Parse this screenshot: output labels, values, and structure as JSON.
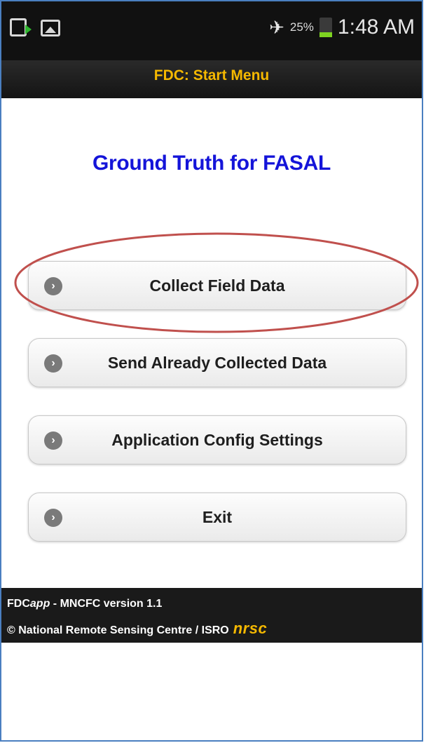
{
  "status_bar": {
    "battery_percent": "25%",
    "time": "1:48 AM",
    "icons": [
      "notification-upload-icon",
      "gallery-icon",
      "airplane-mode-icon",
      "battery-icon"
    ]
  },
  "header": {
    "title": "FDC: Start Menu"
  },
  "main": {
    "heading": "Ground Truth for FASAL",
    "buttons": [
      {
        "label": "Collect Field Data"
      },
      {
        "label": "Send Already Collected Data"
      },
      {
        "label": "Application Config Settings"
      },
      {
        "label": "Exit"
      }
    ],
    "highlight_color": "#c0504d"
  },
  "footer": {
    "app_prefix": "FDC",
    "app_suffix": "app",
    "version_text": " - MNCFC version 1.1",
    "copyright": "© National Remote Sensing Centre / ISRO",
    "logo_text": "nrsc"
  },
  "colors": {
    "header_title": "#f5b800",
    "heading": "#1414d9",
    "status_bar_bg": "#111111"
  }
}
